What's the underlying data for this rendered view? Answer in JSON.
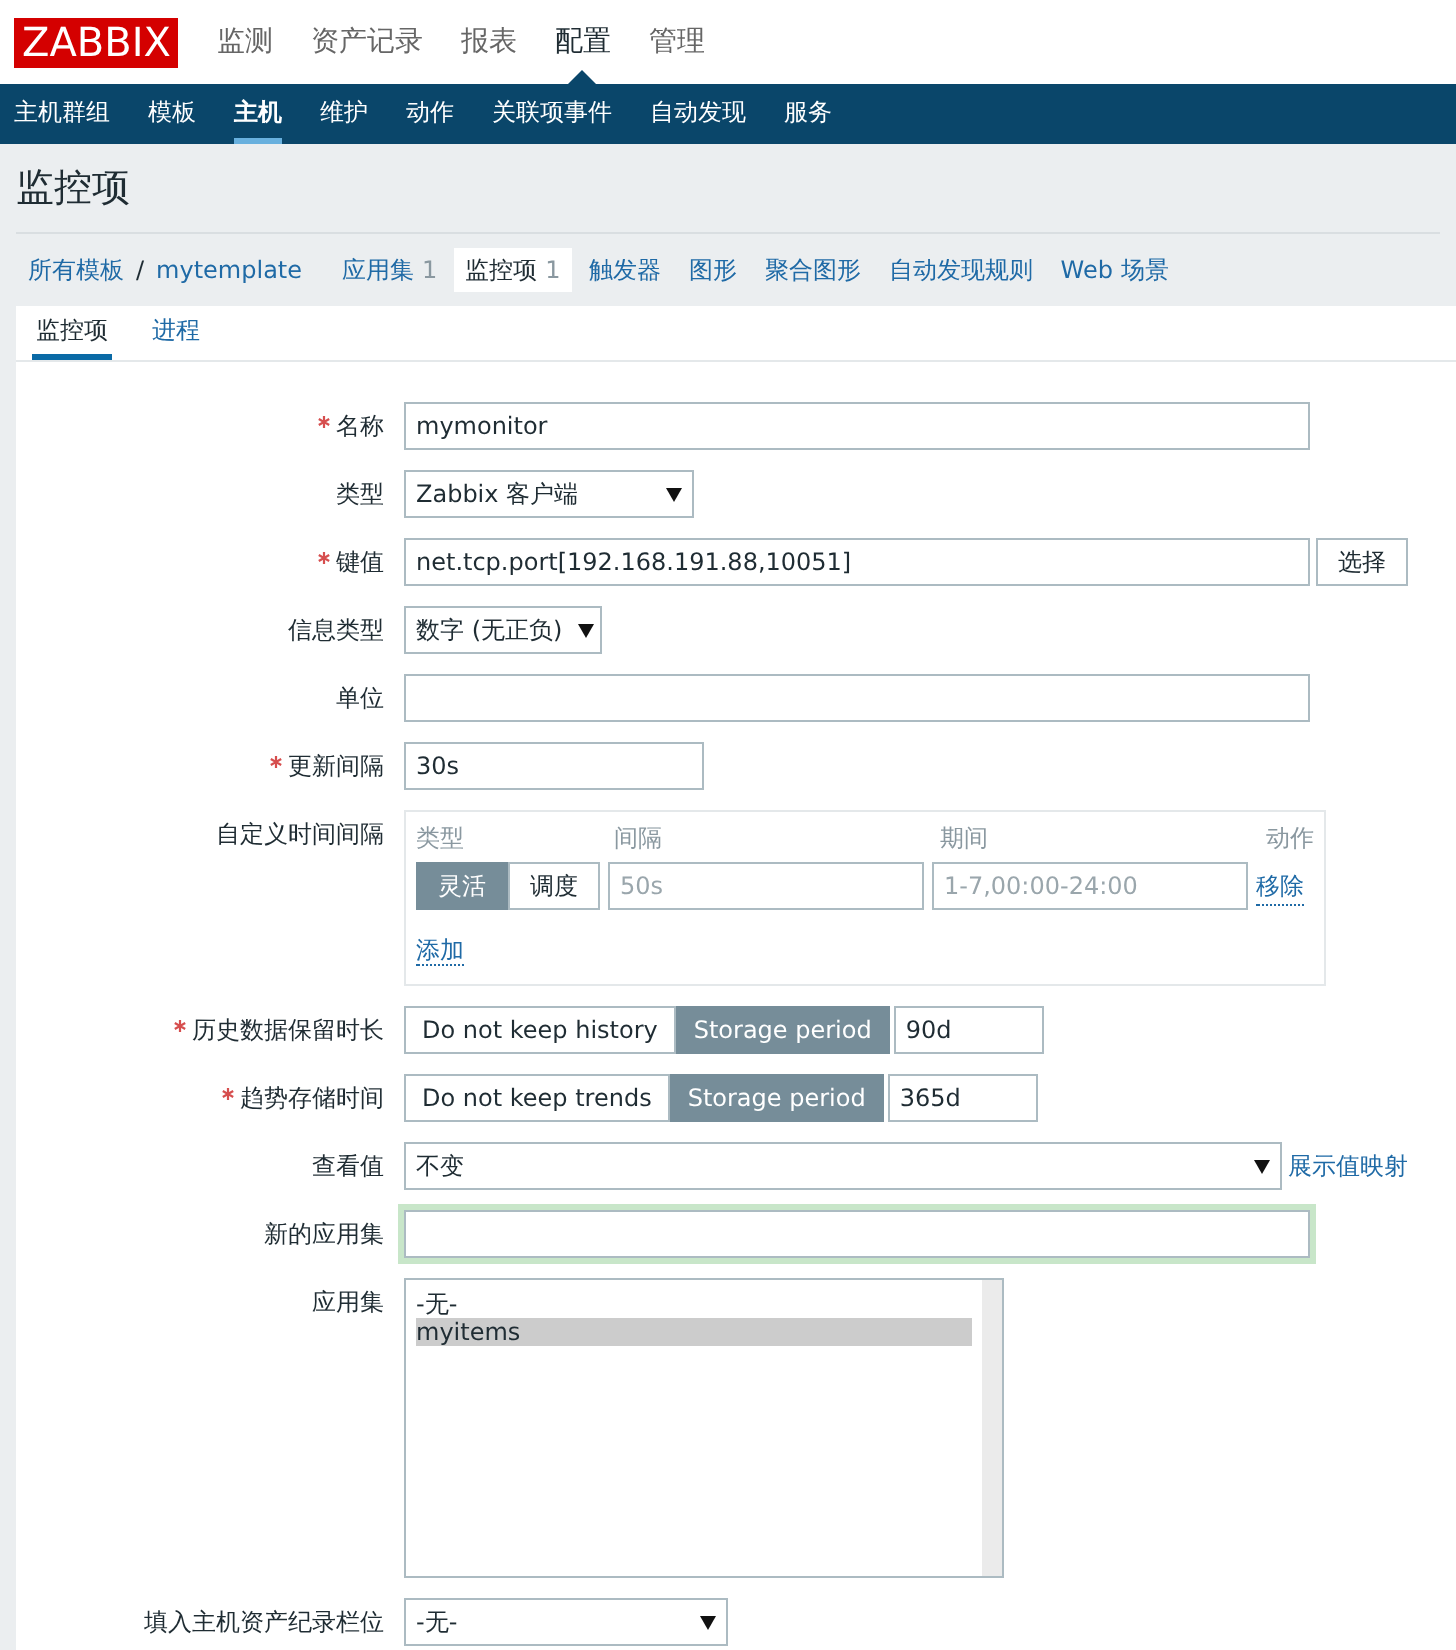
{
  "logo": "ZABBIX",
  "top_menu": [
    {
      "label": "监测",
      "selected": false
    },
    {
      "label": "资产记录",
      "selected": false
    },
    {
      "label": "报表",
      "selected": false
    },
    {
      "label": "配置",
      "selected": true
    },
    {
      "label": "管理",
      "selected": false
    }
  ],
  "sub_menu": [
    {
      "label": "主机群组",
      "selected": false
    },
    {
      "label": "模板",
      "selected": false
    },
    {
      "label": "主机",
      "selected": true
    },
    {
      "label": "维护",
      "selected": false
    },
    {
      "label": "动作",
      "selected": false
    },
    {
      "label": "关联项事件",
      "selected": false
    },
    {
      "label": "自动发现",
      "selected": false
    },
    {
      "label": "服务",
      "selected": false
    }
  ],
  "page_title": "监控项",
  "breadcrumb": {
    "items": [
      "所有模板",
      "mytemplate"
    ],
    "separator": "/"
  },
  "object_tabs": [
    {
      "label": "应用集",
      "count": "1",
      "selected": false
    },
    {
      "label": "监控项",
      "count": "1",
      "selected": true
    },
    {
      "label": "触发器",
      "selected": false
    },
    {
      "label": "图形",
      "selected": false
    },
    {
      "label": "聚合图形",
      "selected": false
    },
    {
      "label": "自动发现规则",
      "selected": false
    },
    {
      "label": "Web 场景",
      "selected": false
    }
  ],
  "form_tabs": [
    {
      "label": "监控项",
      "selected": true
    },
    {
      "label": "进程",
      "selected": false
    }
  ],
  "form": {
    "name": {
      "label": "名称",
      "required": true,
      "value": "mymonitor"
    },
    "type": {
      "label": "类型",
      "value": "Zabbix 客户端"
    },
    "key": {
      "label": "键值",
      "required": true,
      "value": "net.tcp.port[192.168.191.88,10051]",
      "button": "选择"
    },
    "info_type": {
      "label": "信息类型",
      "value": "数字 (无正负)"
    },
    "units": {
      "label": "单位"
    },
    "update_interval": {
      "label": "更新间隔",
      "required": true,
      "value": "30s"
    },
    "custom_intervals": {
      "label": "自定义时间间隔",
      "headers": [
        "类型",
        "间隔",
        "期间",
        "动作"
      ],
      "rows": [
        {
          "modes": [
            {
              "label": "灵活",
              "selected": true
            },
            {
              "label": "调度",
              "selected": false
            }
          ],
          "interval_placeholder": "50s",
          "period_placeholder": "1-7,00:00-24:00",
          "action": "移除"
        }
      ],
      "add_link": "添加"
    },
    "history": {
      "label": "历史数据保留时长",
      "required": true,
      "options": [
        {
          "label": "Do not keep history",
          "selected": false
        },
        {
          "label": "Storage period",
          "selected": true
        }
      ],
      "value": "90d"
    },
    "trends": {
      "label": "趋势存储时间",
      "required": true,
      "options": [
        {
          "label": "Do not keep trends",
          "selected": false
        },
        {
          "label": "Storage period",
          "selected": true
        }
      ],
      "value": "365d"
    },
    "show_value": {
      "label": "查看值",
      "value": "不变",
      "link": "展示值映射"
    },
    "new_application": {
      "label": "新的应用集",
      "focused": true
    },
    "applications": {
      "label": "应用集",
      "items": [
        {
          "label": "-无-",
          "selected": false
        },
        {
          "label": "myitems",
          "selected": true
        }
      ]
    },
    "inventory": {
      "label": "填入主机资产纪录栏位",
      "value": "-无-"
    }
  }
}
